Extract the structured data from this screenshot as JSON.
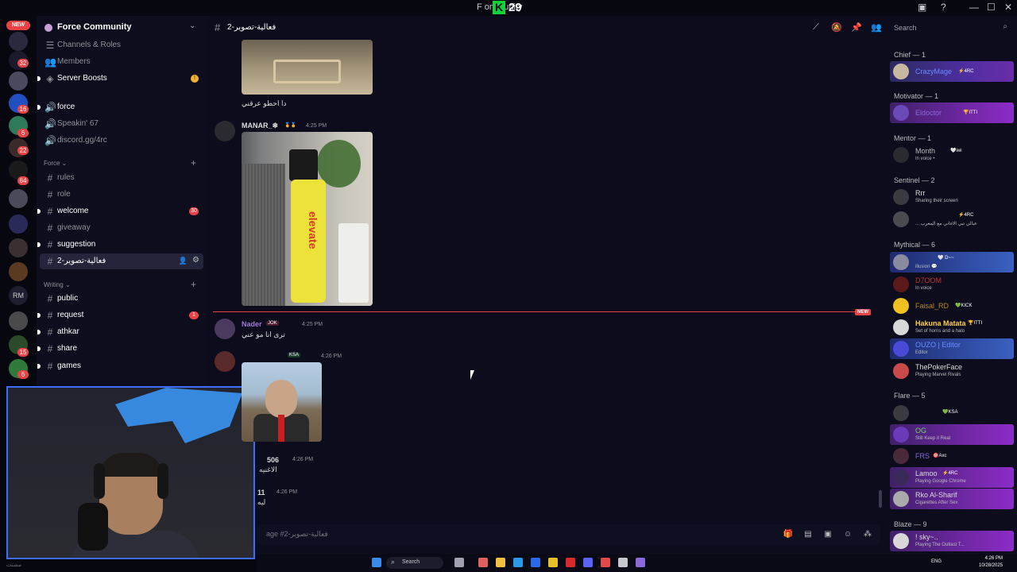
{
  "titlebar": {
    "title": "F   ommunity",
    "overlay_letter": "K",
    "overlay_number": "29",
    "minimize": "—",
    "maximize": "☐",
    "close": "✕"
  },
  "rail": {
    "new_label": "NEW",
    "badges": [
      "32",
      "16",
      "6",
      "22",
      "64",
      "15",
      "6"
    ],
    "rm_label": "RM"
  },
  "server": {
    "name": "Force Community"
  },
  "sidebar": {
    "top_items": [
      {
        "icon": "☰",
        "label": "Channels & Roles"
      },
      {
        "icon": "👥",
        "label": "Members"
      },
      {
        "icon": "◈",
        "label": "Server Boosts",
        "badge": "!"
      }
    ],
    "voice_items": [
      {
        "icon": "🔊",
        "label": "force"
      },
      {
        "icon": "🔊",
        "label": "Speakin' 67"
      },
      {
        "icon": "🔊",
        "label": "discord.gg/4rc"
      }
    ],
    "cat_force": "Force ⌄",
    "force_channels": [
      {
        "label": "rules"
      },
      {
        "label": "role"
      },
      {
        "label": "welcome",
        "badge": "30"
      },
      {
        "label": "giveaway"
      },
      {
        "label": "suggestion"
      },
      {
        "label": "فعالية-تصوير-2"
      }
    ],
    "cat_writing": "Writing ⌄",
    "writing_channels": [
      {
        "label": "public"
      },
      {
        "label": "request",
        "badge": "1"
      },
      {
        "label": "athkar"
      },
      {
        "label": "share"
      },
      {
        "label": "games"
      }
    ]
  },
  "chat": {
    "channel_name": "فعالية-تصوير-2",
    "search_placeholder": "Search",
    "messages": [
      {
        "caption": "دا احطو عرقني"
      },
      {
        "author": "MANAR_❄",
        "time": "4:25 PM"
      },
      {
        "author": "Nader",
        "tag": "JOK",
        "time": "4:25 PM",
        "text": "ترى انا مو عني"
      },
      {
        "author": "",
        "tag": "KSA",
        "time": "4:26 PM"
      },
      {
        "author": "506",
        "time": "4:26 PM",
        "text": "الاغنيه"
      },
      {
        "author": "11",
        "time": "4:26 PM",
        "text": "ليه"
      }
    ],
    "new_label": "NEW",
    "composer_placeholder": "age #فعالية-تصوير-2",
    "spray_text": "elevate"
  },
  "members": {
    "roles": [
      {
        "name": "Chief — 1"
      },
      {
        "name": "Motivator — 1"
      },
      {
        "name": "Mentor — 1"
      },
      {
        "name": "Sentinel — 2"
      },
      {
        "name": "Mythical — 6"
      },
      {
        "name": "Flare — 5"
      },
      {
        "name": "Blaze — 9"
      }
    ],
    "list": [
      {
        "name": "CrazyMage",
        "tag": "⚡4RC",
        "color": "#6b8bff"
      },
      {
        "name": "Eldoctor",
        "tag": "🏆ITTI",
        "color": "#8a6ad8"
      },
      {
        "name": "Month",
        "tag": "🤍iwi",
        "status": "In voice • ",
        "color": "#b9bbbe"
      },
      {
        "name": "Rrr",
        "status": "Sharing their screen",
        "color": "#dcddde"
      },
      {
        "name": "",
        "tag": "⚡4RC",
        "status": "... عبالي تبي الاغاني مع المعرب",
        "color": "#dcddde"
      },
      {
        "name": "",
        "tag": "🤍 D~~",
        "status": "illusion 💬",
        "color": "#dcddde"
      },
      {
        "name": "D7OOM",
        "status": "In voice",
        "color": "#a02020"
      },
      {
        "name": "Faisal_RD",
        "tag": "💚KICK",
        "color": "#b88a20"
      },
      {
        "name": "Hakuna Matata",
        "tag": "🏆ITTI",
        "status": "Set of horns and a halo",
        "color": "#ffd23f"
      },
      {
        "name": "OUZO | Editor",
        "status": "Editor",
        "color": "#6b8bff"
      },
      {
        "name": "ThePokerFace",
        "status": "Playing Marvel Rivals",
        "color": "#dcddde"
      },
      {
        "name": "",
        "tag": "💚KSA",
        "color": "#dcddde"
      },
      {
        "name": "OG",
        "status": "Still Keep it Real",
        "color": "#6ad86a"
      },
      {
        "name": "FRS",
        "tag": "🎯Axc",
        "color": "#8a6ad8"
      },
      {
        "name": "Lamoo",
        "tag": "⚡4RC",
        "status": "Playing Google Chrome",
        "color": "#ffffff"
      },
      {
        "name": "Rko Al-Sharif",
        "status": "Cigarettes After Sex",
        "color": "#ffffff"
      },
      {
        "name": "! sky~..",
        "status": "Playing The Outlast T...",
        "color": "#ffffff"
      }
    ]
  },
  "taskbar": {
    "search_label": "Search",
    "lang": "ENG",
    "time": "4:26 PM",
    "date": "10/28/2025"
  },
  "bottom_left": {
    "text": "مشتت"
  }
}
